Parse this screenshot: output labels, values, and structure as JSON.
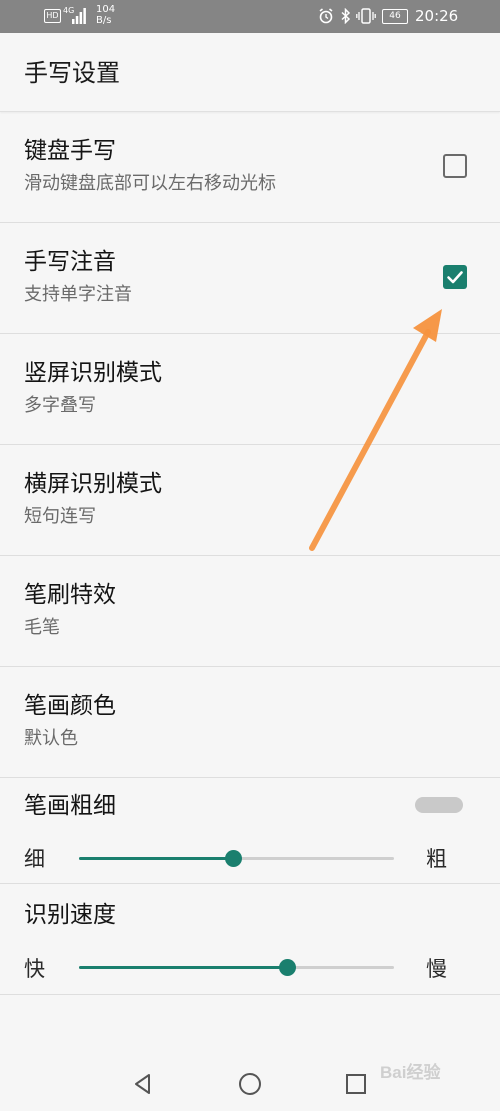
{
  "status_bar": {
    "hd": "HD",
    "signal": "4G",
    "speed_value": "104",
    "speed_unit": "B/s",
    "battery": "46",
    "time": "20:26",
    "icons": [
      "alarm-icon",
      "bluetooth-icon",
      "vibrate-icon",
      "battery-icon"
    ]
  },
  "header": {
    "title": "手写设置"
  },
  "settings": [
    {
      "title": "键盘手写",
      "subtitle": "滑动键盘底部可以左右移动光标",
      "checkbox": "unchecked"
    },
    {
      "title": "手写注音",
      "subtitle": "支持单字注音",
      "checkbox": "checked"
    },
    {
      "title": "竖屏识别模式",
      "subtitle": "多字叠写"
    },
    {
      "title": "横屏识别模式",
      "subtitle": "短句连写"
    },
    {
      "title": "笔刷特效",
      "subtitle": "毛笔"
    },
    {
      "title": "笔画颜色",
      "subtitle": "默认色"
    }
  ],
  "sliders": [
    {
      "title": "笔画粗细",
      "min_label": "细",
      "max_label": "粗",
      "value_fraction": 0.49
    },
    {
      "title": "识别速度",
      "min_label": "快",
      "max_label": "慢",
      "value_fraction": 0.66
    }
  ],
  "colors": {
    "accent": "#1a7f6e",
    "annotation_arrow": "#f5923e"
  },
  "navbar": [
    "back-icon",
    "home-icon",
    "recents-icon"
  ],
  "watermark": "Bai经验"
}
